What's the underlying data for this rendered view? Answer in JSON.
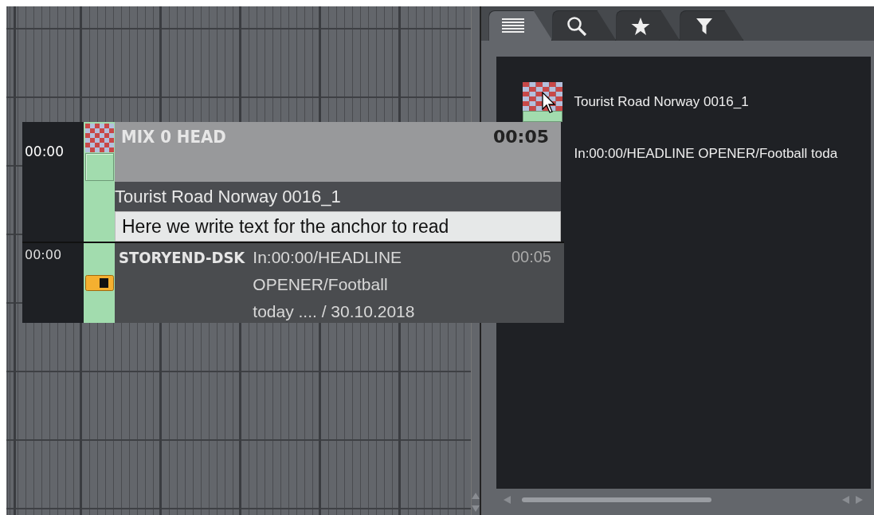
{
  "timeline": {
    "cards": [
      {
        "kind": "mix",
        "time": "00:00",
        "title": "MIX 0 HEAD",
        "duration": "00:05",
        "clip": "Tourist Road Norway 0016_1",
        "script": "Here we write text for the anchor to read"
      },
      {
        "kind": "dsk",
        "time": "00:00",
        "title": "STORYEND-DSK",
        "info": "In:00:00/HEADLINE OPENER/Football today .... / 30.10.2018",
        "duration": "00:05"
      }
    ]
  },
  "sidebar": {
    "tabs": [
      {
        "kind": "list",
        "selected": true
      },
      {
        "kind": "search",
        "selected": false
      },
      {
        "kind": "favorites",
        "selected": false
      },
      {
        "kind": "filter",
        "selected": false
      }
    ],
    "items": [
      {
        "kind": "clip",
        "title": "Tourist Road Norway 0016_1"
      },
      {
        "kind": "text",
        "title": "In:00:00/HEADLINE OPENER/Football toda"
      }
    ]
  }
}
